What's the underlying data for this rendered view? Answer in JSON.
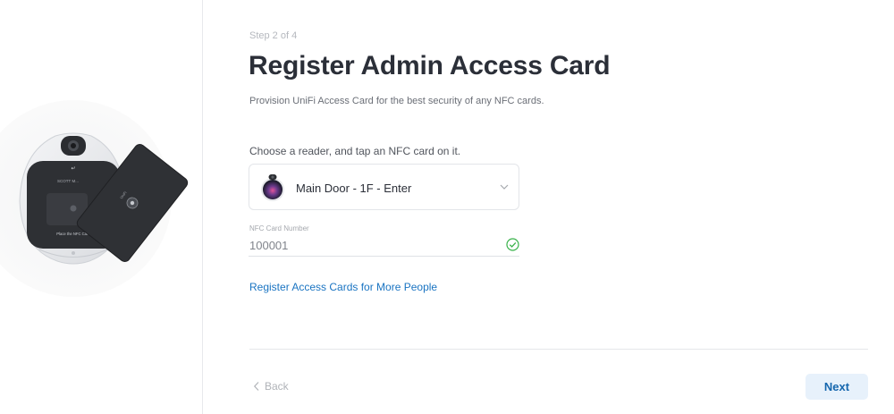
{
  "wizard": {
    "step": "Step 2 of 4",
    "title": "Register Admin Access Card",
    "subtitle": "Provision UniFi Access Card for the best security of any NFC cards."
  },
  "illustration": {
    "reader_brand": "SCOTT M...",
    "reader_prompt": "Place the NFC Card",
    "card_brand": "UniFi"
  },
  "reader": {
    "label": "Choose a reader, and tap an NFC card on it.",
    "selected": "Main Door - 1F - Enter",
    "icon": "reader-camera-icon"
  },
  "nfc": {
    "label": "NFC Card Number",
    "value": "100001",
    "status": "valid",
    "status_color": "#38b24a"
  },
  "links": {
    "register_more": "Register Access Cards for More People"
  },
  "footer": {
    "back_label": "Back",
    "next_label": "Next"
  },
  "colors": {
    "accent": "#1a74c2",
    "next_bg": "#e7f1fb"
  }
}
